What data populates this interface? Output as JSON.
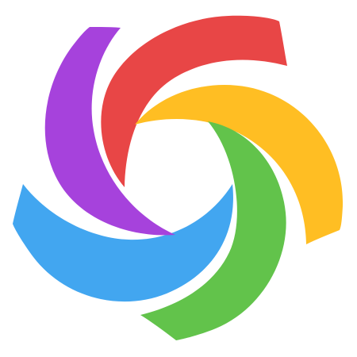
{
  "logo": {
    "icon_name": "pinwheel-logo-icon",
    "petals": [
      {
        "name": "petal-red-icon",
        "color": "#E84646"
      },
      {
        "name": "petal-yellow-icon",
        "color": "#FFBE23"
      },
      {
        "name": "petal-green-icon",
        "color": "#62C34B"
      },
      {
        "name": "petal-blue-icon",
        "color": "#42A6F0"
      },
      {
        "name": "petal-purple-icon",
        "color": "#A642DC"
      }
    ],
    "background": "#FFFFFF"
  }
}
